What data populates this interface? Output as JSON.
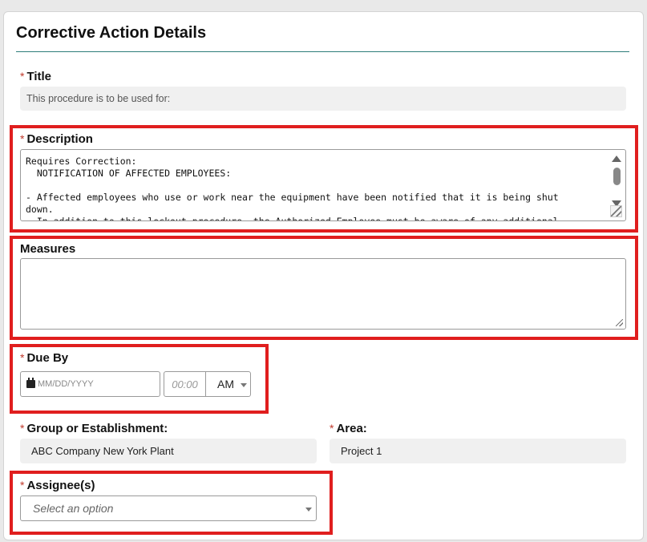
{
  "section": {
    "title": "Corrective Action Details"
  },
  "required_mark": "*",
  "fields": {
    "title": {
      "label": "Title",
      "value": "This procedure is to be used for:"
    },
    "description": {
      "label": "Description",
      "value": "Requires Correction:\n  NOTIFICATION OF AFFECTED EMPLOYEES:\n\n- Affected employees who use or work near the equipment have been notified that it is being shut\ndown.\n- In addition to this lockout procedure, the Authorized Employee must be aware of any additional"
    },
    "measures": {
      "label": "Measures",
      "value": ""
    },
    "due_by": {
      "label": "Due By",
      "date_placeholder": "MM/DD/YYYY",
      "time_placeholder": "00:00",
      "ampm": "AM"
    },
    "group": {
      "label": "Group or Establishment:",
      "value": "ABC Company New York Plant"
    },
    "area": {
      "label": "Area:",
      "value": "Project 1"
    },
    "assignees": {
      "label": "Assignee(s)",
      "placeholder": "Select an option"
    }
  },
  "colors": {
    "highlight": "#e01e1e",
    "accent_line": "#2e7d7a",
    "required": "#c0392b"
  }
}
